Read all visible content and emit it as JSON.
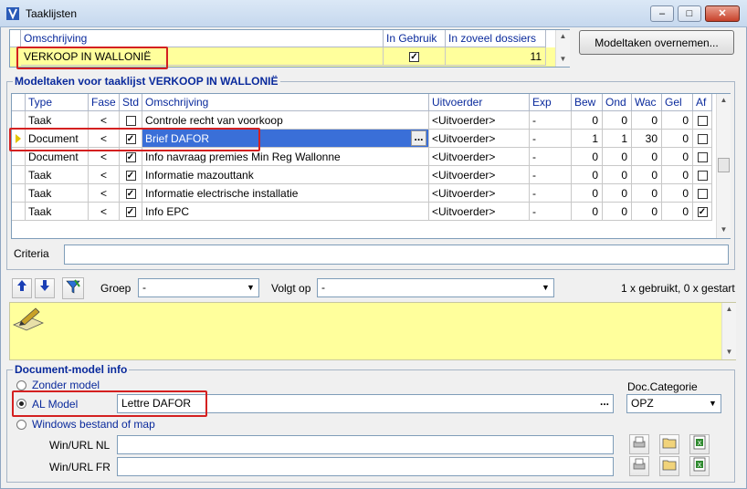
{
  "window": {
    "title": "Taaklijsten"
  },
  "tasklist_grid": {
    "headers": {
      "desc": "Omschrijving",
      "in_use": "In Gebruik",
      "count": "In zoveel dossiers"
    },
    "row": {
      "desc": "VERKOOP IN WALLONIË",
      "in_use": true,
      "count": "11"
    }
  },
  "model_button": "Modeltaken overnemen...",
  "tasks_group": {
    "title": "Modeltaken voor taaklijst VERKOOP IN WALLONIË",
    "headers": {
      "type": "Type",
      "fase": "Fase",
      "std": "Std",
      "desc": "Omschrijving",
      "exec": "Uitvoerder",
      "exp": "Exp",
      "bew": "Bew",
      "ond": "Ond",
      "wac": "Wac",
      "gel": "Gel",
      "af": "Af"
    },
    "rows": [
      {
        "type": "Taak",
        "fase": "<",
        "std": false,
        "desc": "Controle recht van voorkoop",
        "exec": "<Uitvoerder>",
        "exp": "-",
        "bew": "0",
        "ond": "0",
        "wac": "0",
        "gel": "0",
        "af": false
      },
      {
        "type": "Document",
        "fase": "<",
        "std": true,
        "desc": "Brief DAFOR",
        "exec": "<Uitvoerder>",
        "exp": "-",
        "bew": "1",
        "ond": "1",
        "wac": "30",
        "gel": "0",
        "af": false
      },
      {
        "type": "Document",
        "fase": "<",
        "std": true,
        "desc": "Info navraag premies Min Reg Wallonne",
        "exec": "<Uitvoerder>",
        "exp": "-",
        "bew": "0",
        "ond": "0",
        "wac": "0",
        "gel": "0",
        "af": false
      },
      {
        "type": "Taak",
        "fase": "<",
        "std": true,
        "desc": "Informatie mazouttank",
        "exec": "<Uitvoerder>",
        "exp": "-",
        "bew": "0",
        "ond": "0",
        "wac": "0",
        "gel": "0",
        "af": false
      },
      {
        "type": "Taak",
        "fase": "<",
        "std": true,
        "desc": "Informatie electrische installatie",
        "exec": "<Uitvoerder>",
        "exp": "-",
        "bew": "0",
        "ond": "0",
        "wac": "0",
        "gel": "0",
        "af": false
      },
      {
        "type": "Taak",
        "fase": "<",
        "std": true,
        "desc": "Info EPC",
        "exec": "<Uitvoerder>",
        "exp": "-",
        "bew": "0",
        "ond": "0",
        "wac": "0",
        "gel": "0",
        "af": true
      }
    ]
  },
  "criteria": {
    "label": "Criteria",
    "value": ""
  },
  "toolbar": {
    "groep_label": "Groep",
    "groep_value": "-",
    "volgt_label": "Volgt op",
    "volgt_value": "-",
    "status": "1 x gebruikt, 0 x gestart"
  },
  "docmodel": {
    "title": "Document-model info",
    "opt_none": "Zonder model",
    "opt_al": "AL Model",
    "al_value": "Lettre DAFOR",
    "opt_win": "Windows bestand of map",
    "cat_label": "Doc.Categorie",
    "cat_value": "OPZ",
    "win_nl_label": "Win/URL NL",
    "win_fr_label": "Win/URL FR",
    "win_nl_value": "",
    "win_fr_value": ""
  },
  "colors": {
    "row_yellow": "#ffff9c",
    "header_blue": "#0a2a9c",
    "selection": "#3a6fd8",
    "highlight_red": "#d42020"
  }
}
